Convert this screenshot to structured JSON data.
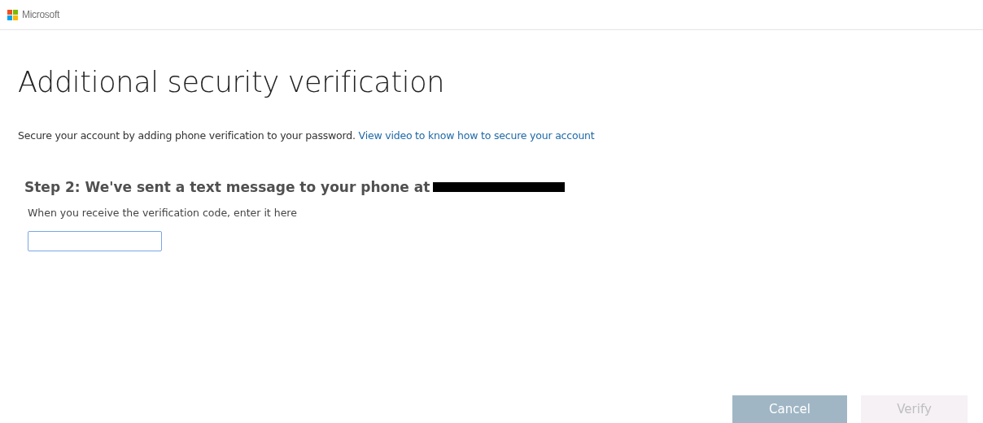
{
  "header": {
    "brand": "Microsoft"
  },
  "title": "Additional security verification",
  "intro": {
    "text": "Secure your account by adding phone verification to your password.",
    "link": "View video to know how to secure your account"
  },
  "step": {
    "heading": "Step 2: We've sent a text message to your phone at",
    "number_redacted": true,
    "hint": "When you receive the verification code, enter it here",
    "code_field": {
      "focused": true
    }
  },
  "buttons": [
    {
      "label": "Cancel",
      "disabled": false
    },
    {
      "label": "Verify",
      "disabled": true
    }
  ]
}
